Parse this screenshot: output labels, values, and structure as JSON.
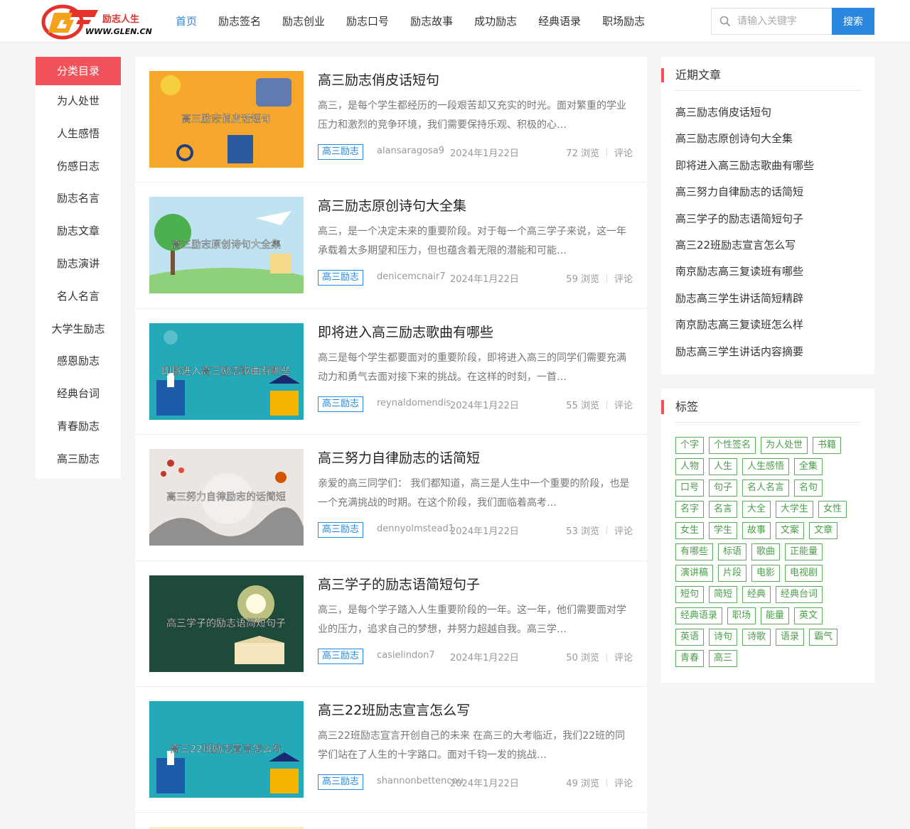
{
  "site": {
    "logo_name": "励志人生",
    "logo_url": "WWW.GLEN.CN"
  },
  "nav": [
    {
      "label": "首页",
      "active": true
    },
    {
      "label": "励志签名"
    },
    {
      "label": "励志创业"
    },
    {
      "label": "励志口号"
    },
    {
      "label": "励志故事"
    },
    {
      "label": "成功励志"
    },
    {
      "label": "经典语录"
    },
    {
      "label": "职场励志"
    }
  ],
  "search": {
    "placeholder": "请输入关键字",
    "button_label": "搜索"
  },
  "categories": {
    "title": "分类目录",
    "items": [
      "为人处世",
      "人生感悟",
      "伤感日志",
      "励志名言",
      "励志文章",
      "励志演讲",
      "名人名言",
      "大学生励志",
      "感恩励志",
      "经典台词",
      "青春励志",
      "高三励志"
    ]
  },
  "articles": [
    {
      "title": "高三励志俏皮话短句",
      "excerpt": "高三，是每个学生都经历的一段艰苦却又充实的时光。面对繁重的学业压力和激烈的竞争环境，我们需要保持乐观、积极的心…",
      "tag": "高三励志",
      "author": "alansaragosa9",
      "date": "2024年1月22日",
      "views": "72 浏览",
      "comment": "评论",
      "thumb_text": "高三励志俏皮话短句",
      "thumb_bg": "#f7a72b"
    },
    {
      "title": "高三励志原创诗句大全集",
      "excerpt": "高三，是一个决定未来的重要阶段。对于每一个高三学子来说，这一年承载着太多期望和压力，但也蕴含着无限的潜能和可能…",
      "tag": "高三励志",
      "author": "denicemcnair7",
      "date": "2024年1月22日",
      "views": "59 浏览",
      "comment": "评论",
      "thumb_text": "高三励志原创诗句大全集",
      "thumb_bg": "#bfe3f1"
    },
    {
      "title": "即将进入高三励志歌曲有哪些",
      "excerpt": "高三是每个学生都要面对的重要阶段，即将进入高三的同学们需要充满动力和勇气去面对接下来的挑战。在这样的时刻，一首…",
      "tag": "高三励志",
      "author": "reynaldomendis",
      "date": "2024年1月22日",
      "views": "55 浏览",
      "comment": "评论",
      "thumb_text": "即将进入高三励志歌曲有哪些",
      "thumb_bg": "#23a9b8"
    },
    {
      "title": "高三努力自律励志的话简短",
      "excerpt": "亲爱的高三同学们： 我们都知道，高三是人生中一个重要的阶段，也是一个充满挑战的时期。在这个阶段，我们面临着高考…",
      "tag": "高三励志",
      "author": "dennyolmstead1",
      "date": "2024年1月22日",
      "views": "53 浏览",
      "comment": "评论",
      "thumb_text": "高三努力自律励志的话简短",
      "thumb_bg": "#ece6e2"
    },
    {
      "title": "高三学子的励志语简短句子",
      "excerpt": "高三，是每个学子踏入人生重要阶段的一年。这一年，他们需要面对学业的压力，追求自己的梦想，并努力超越自我。高三学…",
      "tag": "高三励志",
      "author": "casielindon7",
      "date": "2024年1月22日",
      "views": "50 浏览",
      "comment": "评论",
      "thumb_text": "高三学子的励志语简短句子",
      "thumb_bg": "#1e4a3a"
    },
    {
      "title": "高三22班励志宣言怎么写",
      "excerpt": "高三22班励志宣言开创自己的未来 在高三的大考临近，我们22班的同学们站在了人生的十字路口。面对千钧一发的挑战…",
      "tag": "高三励志",
      "author": "shannonbettencou",
      "date": "2024年1月22日",
      "views": "49 浏览",
      "comment": "评论",
      "thumb_text": "高三22班励志宣言怎么写",
      "thumb_bg": "#23a9b8"
    }
  ],
  "recent": {
    "title": "近期文章",
    "items": [
      "高三励志俏皮话短句",
      "高三励志原创诗句大全集",
      "即将进入高三励志歌曲有哪些",
      "高三努力自律励志的话简短",
      "高三学子的励志语简短句子",
      "高三22班励志宣言怎么写",
      "南京励志高三复读班有哪些",
      "励志高三学生讲话简短精辟",
      "南京励志高三复读班怎么样",
      "励志高三学生讲话内容摘要"
    ]
  },
  "tags": {
    "title": "标签",
    "items": [
      "个字",
      "个性签名",
      "为人处世",
      "书籍",
      "人物",
      "人生",
      "人生感悟",
      "全集",
      "口号",
      "句子",
      "名人名言",
      "名句",
      "名字",
      "名言",
      "大全",
      "大学生",
      "女性",
      "女生",
      "学生",
      "故事",
      "文案",
      "文章",
      "有哪些",
      "标语",
      "歌曲",
      "正能量",
      "演讲稿",
      "片段",
      "电影",
      "电视剧",
      "短句",
      "简短",
      "经典",
      "经典台词",
      "经典语录",
      "职场",
      "能量",
      "英文",
      "英语",
      "诗句",
      "诗歌",
      "语录",
      "霸气",
      "青春",
      "高三"
    ]
  },
  "colors": {
    "accent_blue": "#2a87e0",
    "accent_red": "#f2525a",
    "tag_green": "#5cad5c"
  }
}
